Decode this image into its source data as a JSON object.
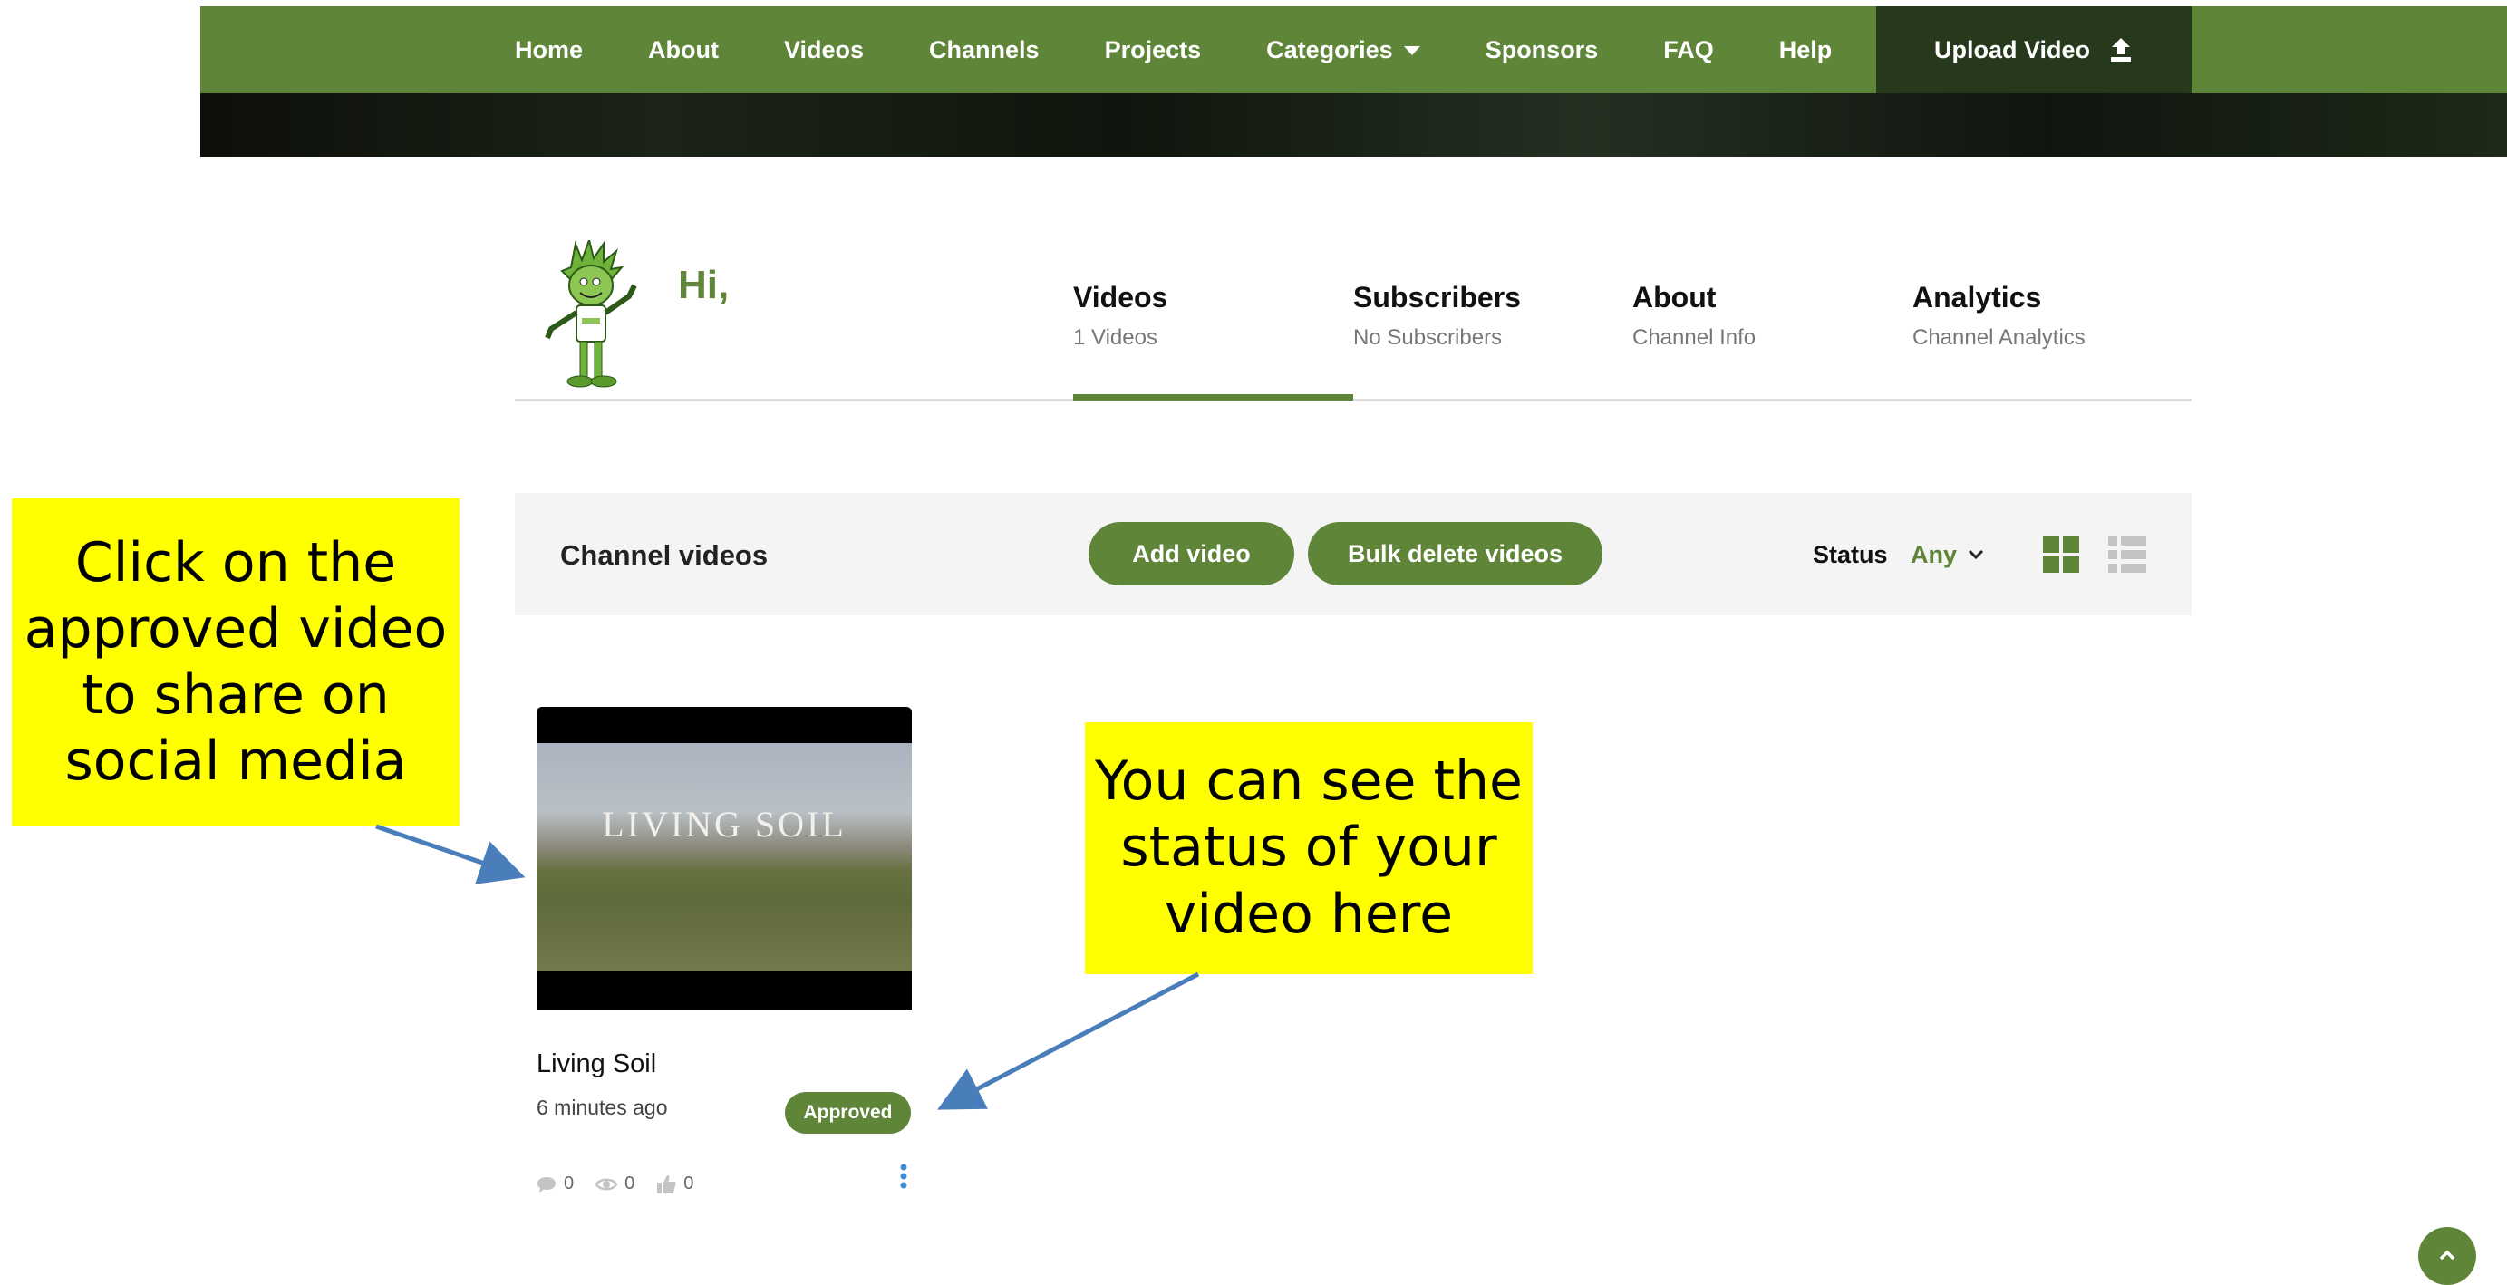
{
  "nav": {
    "items": [
      "Home",
      "About",
      "Videos",
      "Channels",
      "Projects",
      "Categories",
      "Sponsors",
      "FAQ",
      "Help"
    ],
    "upload_label": "Upload Video"
  },
  "profile": {
    "greeting": "Hi,"
  },
  "tabs": [
    {
      "title": "Videos",
      "sub": "1 Videos",
      "active": true
    },
    {
      "title": "Subscribers",
      "sub": "No Subscribers",
      "active": false
    },
    {
      "title": "About",
      "sub": "Channel Info",
      "active": false
    },
    {
      "title": "Analytics",
      "sub": "Channel Analytics",
      "active": false
    }
  ],
  "toolbar": {
    "title": "Channel videos",
    "add_label": "Add video",
    "bulk_delete_label": "Bulk delete videos",
    "status_label": "Status",
    "status_value": "Any"
  },
  "video": {
    "thumb_text": "LIVING SOIL",
    "title": "Living Soil",
    "time": "6 minutes ago",
    "status": "Approved",
    "comments": "0",
    "views": "0",
    "likes": "0"
  },
  "annotations": {
    "callout1": "Click on the approved video to share on social media",
    "callout2": "You can see the status of your video here"
  },
  "colors": {
    "brand_green": "#5e8538",
    "dark_green": "#27391c",
    "callout_yellow": "#ffff00",
    "arrow_blue": "#4a7ebb"
  },
  "icons": {
    "upload": "upload-icon",
    "comment": "comment-icon",
    "views": "eye-icon",
    "likes": "thumbs-up-icon",
    "grid": "grid-view-icon",
    "list": "list-view-icon"
  }
}
